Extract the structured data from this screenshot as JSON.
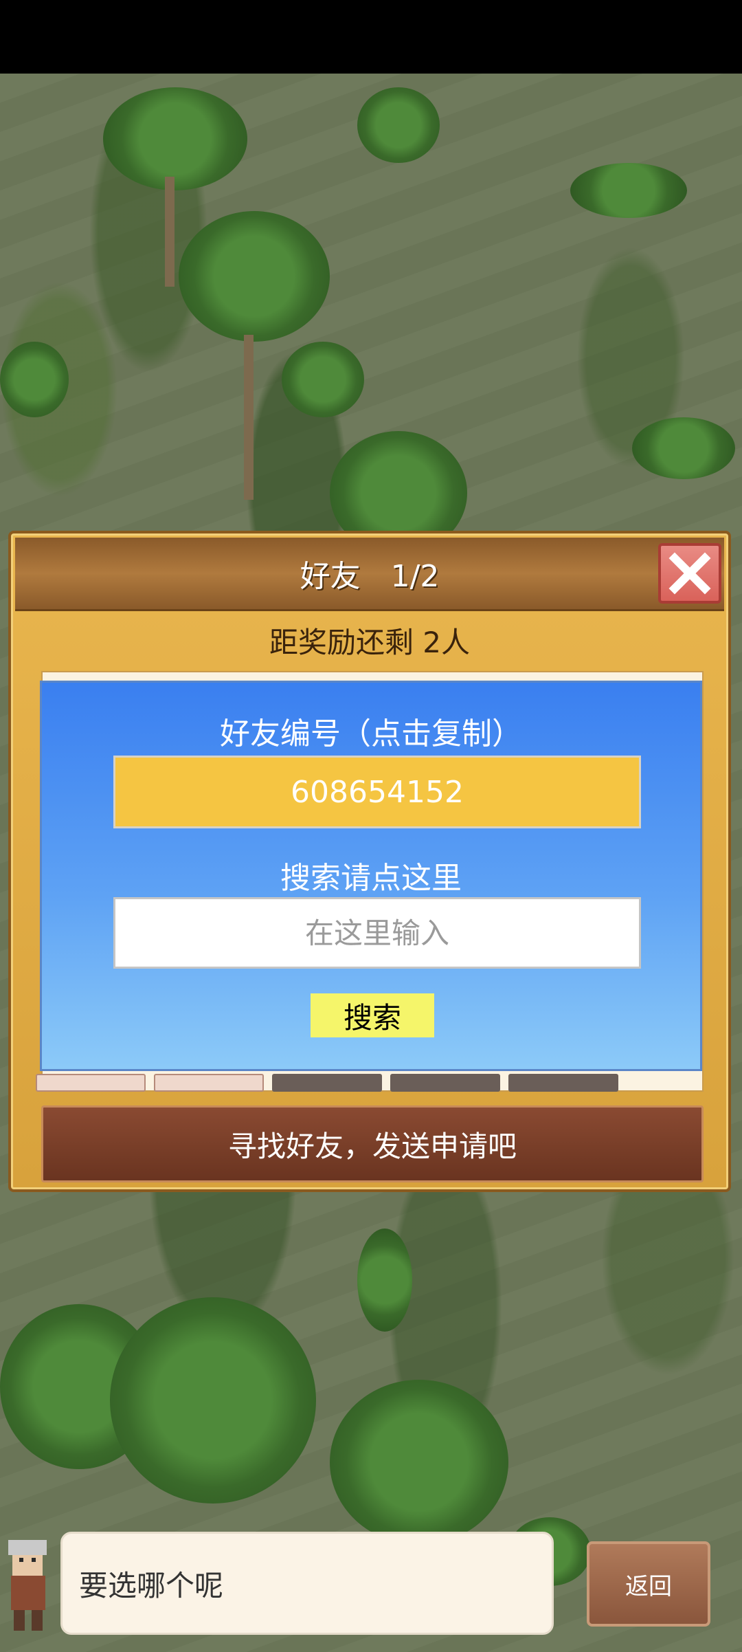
{
  "dialog": {
    "title": "好友　1/2",
    "reward_text": "距奖励还剩 2人",
    "find_banner": "寻找好友，发送申请吧"
  },
  "popup": {
    "id_label": "好友编号（点击复制）",
    "friend_id": "608654152",
    "search_label": "搜索请点这里",
    "search_placeholder": "在这里输入",
    "search_button": "搜索"
  },
  "bottom": {
    "speech": "要选哪个呢",
    "back_button": "返回"
  },
  "icons": {
    "close": "close-icon",
    "left_arrow": "left-arrow-icon",
    "right_arrow": "right-arrow-icon"
  },
  "colors": {
    "popup_blue": "#3a7ff0",
    "id_box": "#f5c542",
    "search_button": "#f5f56a",
    "close_button": "#d9625a"
  }
}
